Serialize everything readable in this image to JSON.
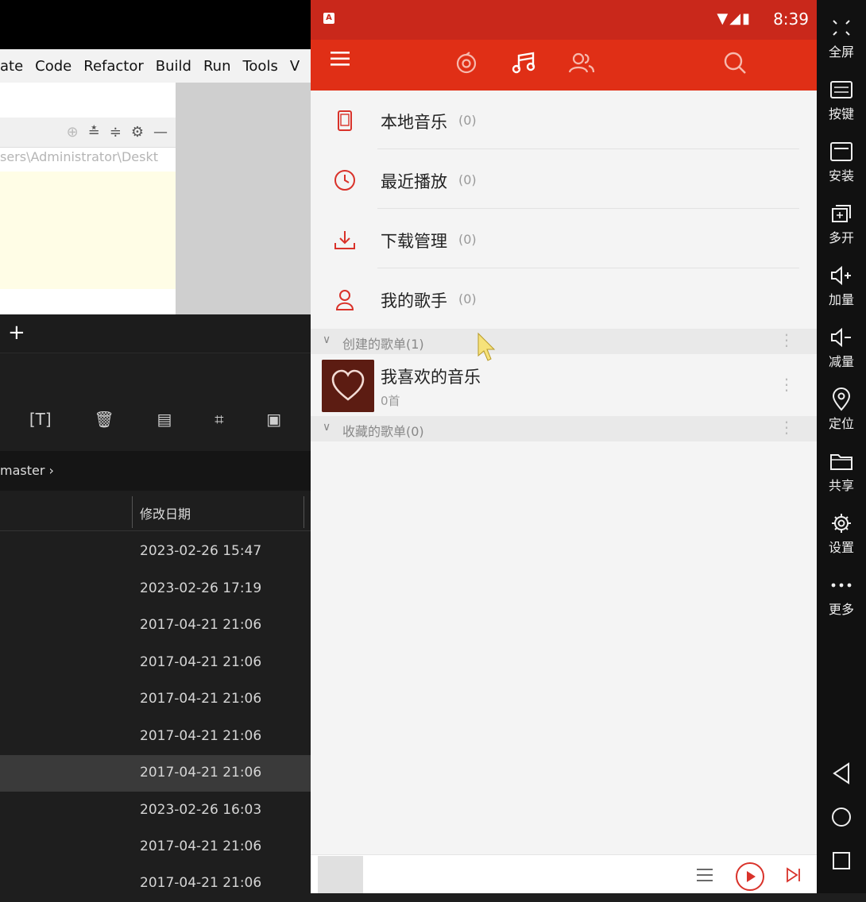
{
  "ide": {
    "menu": [
      "ate",
      "Code",
      "Refactor",
      "Build",
      "Run",
      "Tools",
      "V"
    ],
    "path": "sers\\Administrator\\Deskt",
    "branch": "master ›",
    "column_header": "修改日期",
    "rows": [
      "2023-02-26 15:47",
      "2023-02-26 17:19",
      "2017-04-21 21:06",
      "2017-04-21 21:06",
      "2017-04-21 21:06",
      "2017-04-21 21:06",
      "2017-04-21 21:06",
      "2023-02-26 16:03",
      "2017-04-21 21:06",
      "2017-04-21 21:06"
    ],
    "plus": "+"
  },
  "phone": {
    "status": {
      "app_icon": "A",
      "time": "8:39",
      "signals": "▼◢▮"
    },
    "menu": [
      {
        "label": "本地音乐",
        "count": "(0)",
        "icon": "phone-icon"
      },
      {
        "label": "最近播放",
        "count": "(0)",
        "icon": "clock-icon"
      },
      {
        "label": "下载管理",
        "count": "(0)",
        "icon": "download-icon"
      },
      {
        "label": "我的歌手",
        "count": "(0)",
        "icon": "singer-icon"
      }
    ],
    "created_section": "创建的歌单(1)",
    "collected_section": "收藏的歌单(0)",
    "playlist": {
      "name": "我喜欢的音乐",
      "count": "0首"
    },
    "colors": {
      "accent": "#e02f16",
      "statusbar": "#c9281b"
    }
  },
  "emulator": {
    "buttons": [
      "全屏",
      "按键",
      "安装",
      "多开",
      "加量",
      "减量",
      "定位",
      "共享",
      "设置",
      "更多"
    ]
  }
}
